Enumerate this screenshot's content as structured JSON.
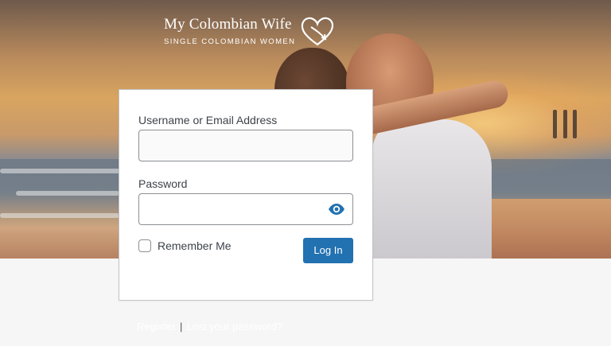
{
  "brand": {
    "title": "My Colombian Wife",
    "subtitle": "SINGLE COLOMBIAN WOMEN"
  },
  "form": {
    "username_label": "Username or Email Address",
    "username_value": "",
    "password_label": "Password",
    "password_value": "",
    "remember_label": "Remember Me",
    "remember_checked": false,
    "submit_label": "Log In"
  },
  "icons": {
    "password_toggle": "eye-icon",
    "logo_mark": "heart-icon"
  },
  "links": {
    "register": "Register",
    "separator": "|",
    "lost_password": "Lost your password?"
  },
  "colors": {
    "primary": "#2271b1",
    "page_bg": "#f6f6f6",
    "label_text": "#3c434a"
  }
}
